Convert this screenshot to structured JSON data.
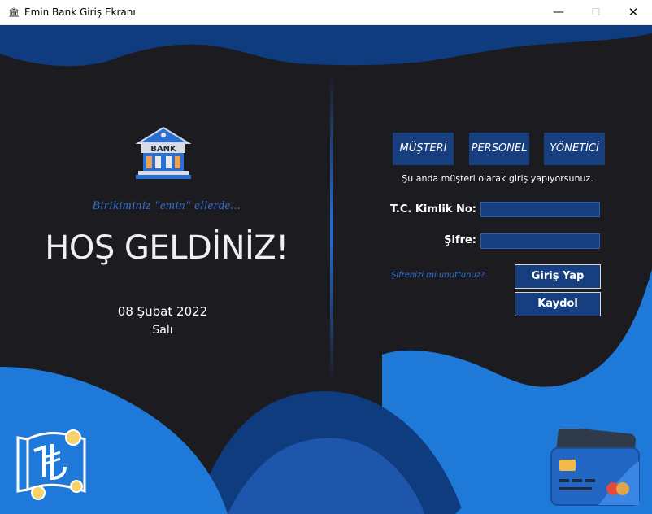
{
  "window": {
    "title": "Emin Bank Giriş Ekranı",
    "controls": {
      "minimize": "—",
      "maximize": "☐",
      "close": "✕"
    }
  },
  "left": {
    "logo_text": "BANK",
    "slogan": "Birikiminiz \"emin\" ellerde...",
    "welcome": "HOŞ GELDİNİZ!",
    "date": "08 Şubat 2022",
    "day": "Salı"
  },
  "roles": [
    "MÜŞTERİ",
    "PERSONEL",
    "YÖNETİCİ"
  ],
  "login": {
    "info": "Şu anda müşteri olarak giriş yapıyorsunuz.",
    "tc_label": "T.C. Kimlik No:",
    "tc_value": "",
    "password_label": "Şifre:",
    "password_value": "",
    "forgot": "Şifrenizi mi unuttunuz?",
    "login_button": "Giriş Yap",
    "register_button": "Kaydol"
  },
  "colors": {
    "background": "#1c1b20",
    "wave_dark": "#0f3b7f",
    "wave_mid": "#1d56ab",
    "wave_light": "#1f79d8",
    "button": "#173f80",
    "accent_text": "#2d74d6"
  }
}
